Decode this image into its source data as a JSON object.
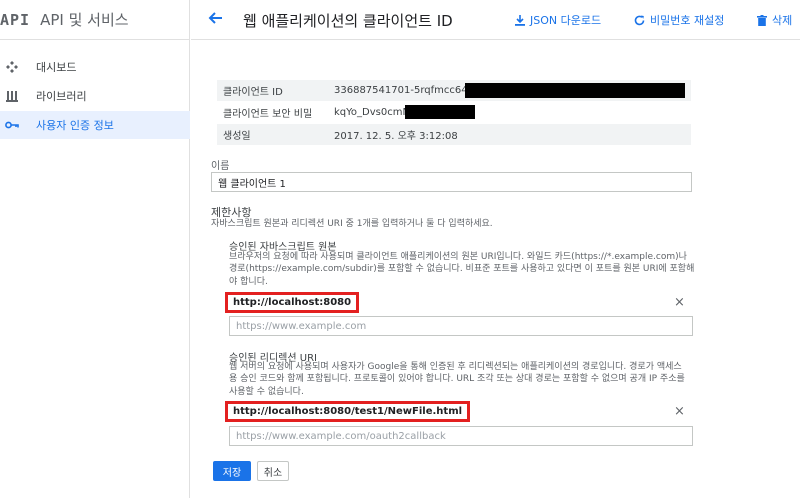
{
  "sidebar": {
    "logo": "API",
    "title": "API 및 서비스",
    "items": [
      {
        "label": "대시보드",
        "icon": "dashboard-icon"
      },
      {
        "label": "라이브러리",
        "icon": "library-icon"
      },
      {
        "label": "사용자 인증 정보",
        "icon": "key-icon"
      }
    ]
  },
  "header": {
    "title": "웹 애플리케이션의 클라이언트 ID",
    "json_download": "JSON 다운로드",
    "reset_secret": "비밀번호 재설정",
    "delete": "삭제"
  },
  "info": {
    "client_id_label": "클라이언트 ID",
    "client_id_value": "336887541701-5rqfmcc64lt4",
    "secret_label": "클라이언트 보안 비밀",
    "secret_value": "kqYo_Dvs0cmM",
    "created_label": "생성일",
    "created_value": "2017. 12. 5. 오후 3:12:08"
  },
  "form": {
    "name_label": "이름",
    "name_value": "웹 클라이언트 1",
    "restrictions_title": "제한사항",
    "restrictions_desc": "자바스크립트 원본과 리디렉션 URI 중 1개를 입력하거나 둘 다 입력하세요.",
    "js_origins_title": "승인된 자바스크립트 원본",
    "js_origins_desc": [
      "브라우저의 요청에 따라 사용되며 클라이언트 애플리케이션의 원본 URI입니다. 와일드 카드(https://*.example.com)나",
      "경로(https://example.com/subdir)를 포함할 수 없습니다. 비표준 포트를 사용하고 있다면 이 포트를 원본 URI에 포함해",
      "야 합니다."
    ],
    "js_origin_value": "http://localhost:8080",
    "js_origin_placeholder": "https://www.example.com",
    "redirect_title": "승인된 리디렉션 URI",
    "redirect_desc": [
      "웹 서버의 요청에 사용되며 사용자가 Google을 통해 인증된 후 리디렉션되는 애플리케이션의 경로입니다. 경로가 액세스",
      "용 승인 코드와 함께 포함됩니다. 프로토콜이 있어야 합니다. URL 조각 또는 상대 경로는 포함할 수 없으며 공개 IP 주소를",
      "사용할 수 없습니다."
    ],
    "redirect_value": "http://localhost:8080/test1/NewFile.html",
    "redirect_placeholder": "https://www.example.com/oauth2callback",
    "remove_glyph": "×",
    "save": "저장",
    "cancel": "취소"
  },
  "colors": {
    "accent": "#1a73e8",
    "highlight_border": "#e32020",
    "active_bg": "#e8f0fe"
  }
}
